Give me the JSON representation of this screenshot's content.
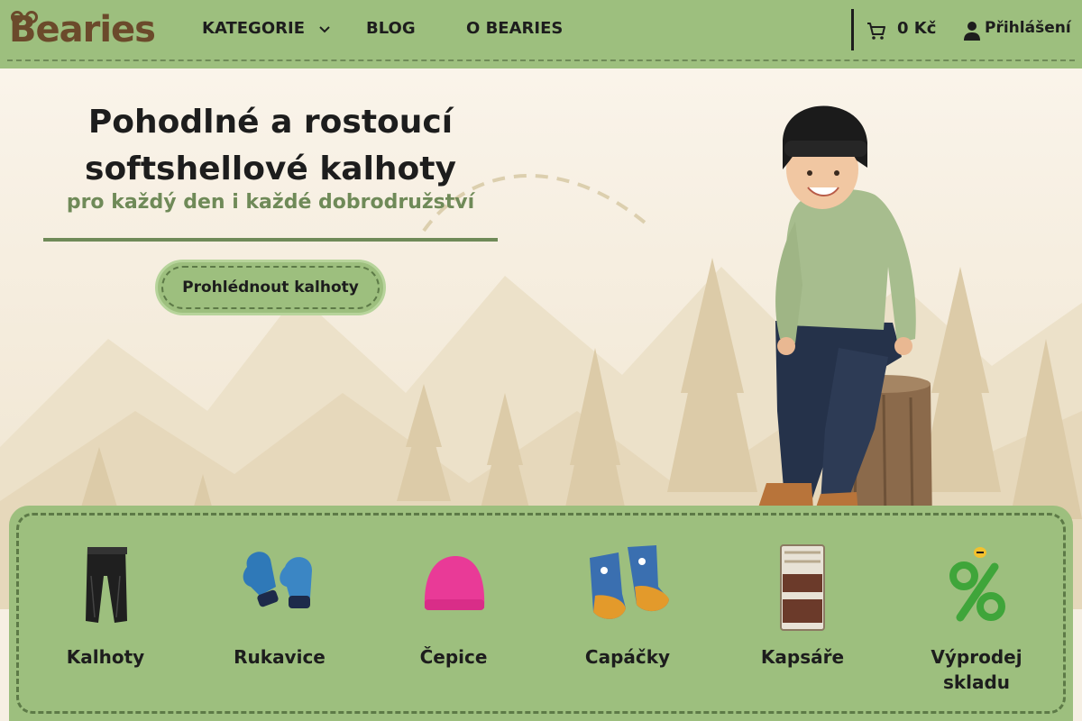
{
  "header": {
    "logo": "Bearies",
    "nav": [
      {
        "label": "KATEGORIE"
      },
      {
        "label": "BLOG"
      },
      {
        "label": "O BEARIES"
      }
    ],
    "cart_total": "0 Kč",
    "login_label": "Přihlášení"
  },
  "hero": {
    "headline_line1": "Pohodlné a rostoucí",
    "headline_line2": "softshellové kalhoty",
    "subheadline": "pro každý den i každé dobrodružství",
    "cta_label": "Prohlédnout kalhoty"
  },
  "categories": [
    {
      "label": "Kalhoty",
      "icon": "pants-icon"
    },
    {
      "label": "Rukavice",
      "icon": "mittens-icon"
    },
    {
      "label": "Čepice",
      "icon": "hat-icon"
    },
    {
      "label": "Capáčky",
      "icon": "booties-icon"
    },
    {
      "label": "Kapsáře",
      "icon": "wall-organizer-icon"
    },
    {
      "label_line1": "Výprodej",
      "label_line2": "skladu",
      "icon": "sale-percent-icon"
    }
  ],
  "colors": {
    "header_green": "#9dbf7e",
    "dark_green": "#6f8a58",
    "logo_brown": "#6b4a2b",
    "text_dark": "#1d1d1d",
    "hero_background": "#f6efe3"
  }
}
